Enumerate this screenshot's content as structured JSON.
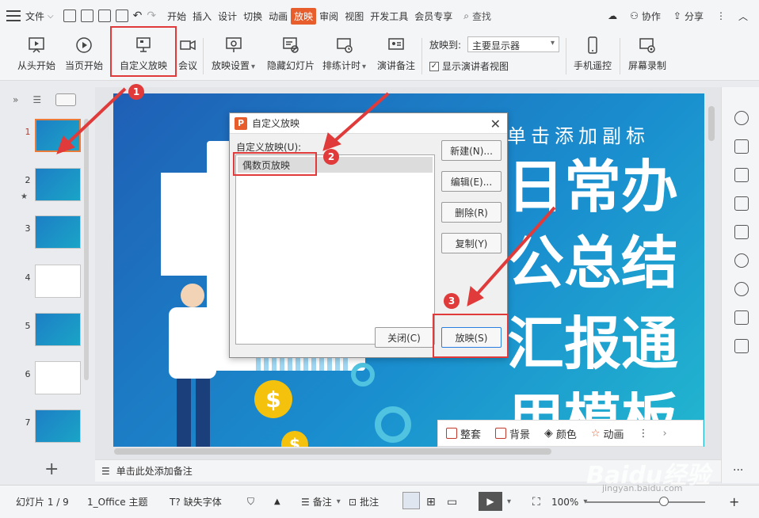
{
  "menubar": {
    "file_label": "文件",
    "tabs": [
      "开始",
      "插入",
      "设计",
      "切换",
      "动画",
      "放映",
      "审阅",
      "视图",
      "开发工具",
      "会员专享"
    ],
    "active_tab": "放映",
    "search_label": "查找",
    "collab_label": "协作",
    "share_label": "分享"
  },
  "ribbon": {
    "from_start": "从头开始",
    "from_current": "当页开始",
    "custom_show": "自定义放映",
    "meeting": "会议",
    "show_settings": "放映设置",
    "hide_slide": "隐藏幻灯片",
    "rehearse": "排练计时",
    "speaker_notes": "演讲备注",
    "show_to_label": "放映到:",
    "show_to_value": "主要显示器",
    "presenter_view": "显示演讲者视图",
    "phone_remote": "手机遥控",
    "screen_record": "屏幕录制"
  },
  "thumbnails": [
    {
      "num": "1"
    },
    {
      "num": "2"
    },
    {
      "num": "3"
    },
    {
      "num": "4"
    },
    {
      "num": "5"
    },
    {
      "num": "6"
    },
    {
      "num": "7"
    }
  ],
  "slide": {
    "subtitle": "单击添加副标",
    "title_lines": [
      "日常办",
      "公总结",
      "汇报通",
      "用模板"
    ]
  },
  "dialog": {
    "title": "自定义放映",
    "list_label": "自定义放映(U):",
    "list_items": [
      "偶数页放映"
    ],
    "new_btn": "新建(N)...",
    "edit_btn": "编辑(E)...",
    "delete_btn": "删除(R)",
    "copy_btn": "复制(Y)",
    "close_btn": "关闭(C)",
    "show_btn": "放映(S)"
  },
  "badges": [
    "1",
    "2",
    "3"
  ],
  "float_bar": {
    "layout": "整套",
    "background": "背景",
    "color": "颜色",
    "animation": "动画"
  },
  "notes": {
    "placeholder": "单击此处添加备注"
  },
  "statusbar": {
    "slide_count": "幻灯片 1 / 9",
    "theme": "1_Office 主题",
    "missing_font": "缺失字体",
    "notes": "备注",
    "comments": "批注",
    "zoom": "100%"
  },
  "watermark": {
    "main": "Baidu经验",
    "sub": "jingyan.baidu.com"
  }
}
